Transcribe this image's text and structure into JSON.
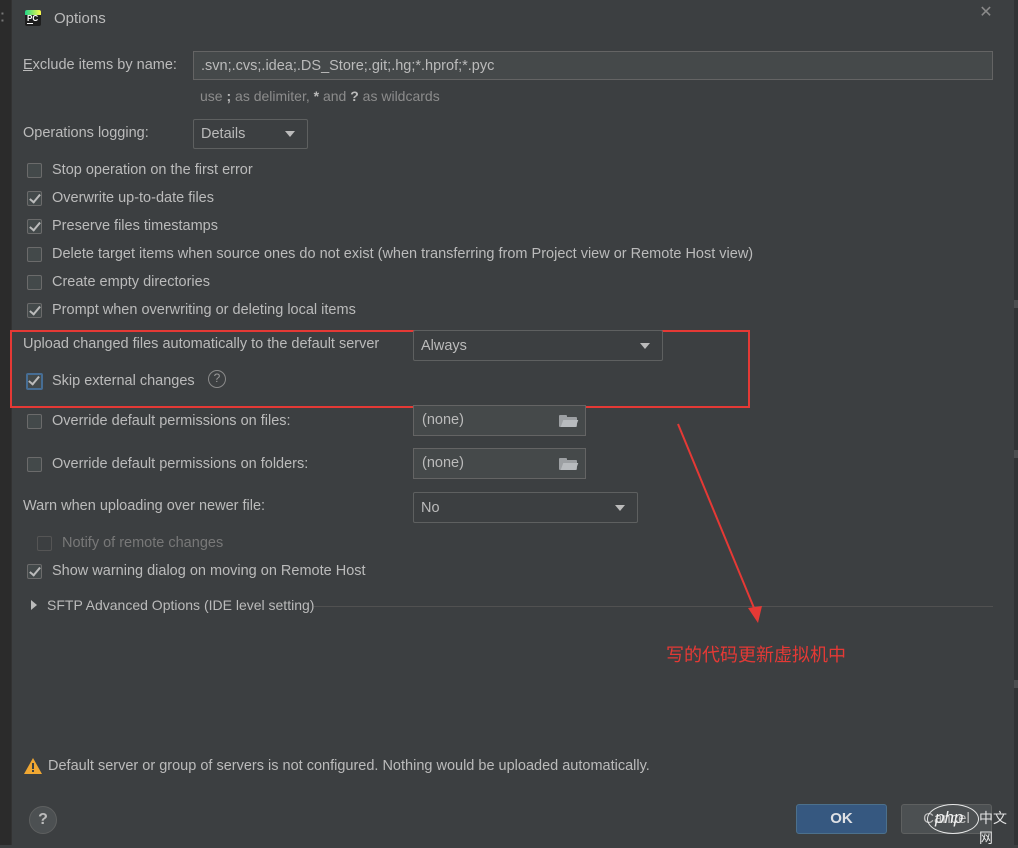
{
  "window": {
    "title": "Options",
    "app_icon_text": "PC"
  },
  "exclude": {
    "label": "Exclude items by name:",
    "value": ".svn;.cvs;.idea;.DS_Store;.git;.hg;*.hprof;*.pyc",
    "hint_pre": "use ",
    "hint_semicolon": ";",
    "hint_mid1": " as delimiter, ",
    "hint_star": "*",
    "hint_mid2": " and ",
    "hint_q": "?",
    "hint_post": " as wildcards"
  },
  "logging": {
    "label": "Operations logging:",
    "value": "Details"
  },
  "checkboxes": [
    {
      "label": "Stop operation on the first error",
      "checked": false
    },
    {
      "label": "Overwrite up-to-date files",
      "checked": true
    },
    {
      "label": "Preserve files timestamps",
      "checked": true
    },
    {
      "label": "Delete target items when source ones do not exist (when transferring from Project view or Remote Host view)",
      "checked": false
    },
    {
      "label": "Create empty directories",
      "checked": false
    },
    {
      "label": "Prompt when overwriting or deleting local items",
      "checked": true
    }
  ],
  "upload": {
    "label": "Upload changed files automatically to the default server",
    "value": "Always",
    "skip_label": "Skip external changes",
    "skip_checked": true,
    "help_glyph": "?"
  },
  "permissions": {
    "files_label": "Override default permissions on files:",
    "files_value": "(none)",
    "folders_label": "Override default permissions on folders:",
    "folders_value": "(none)"
  },
  "warn": {
    "label": "Warn when uploading over newer file:",
    "value": "No"
  },
  "notify": {
    "label": "Notify of remote changes",
    "checked": false,
    "disabled": true
  },
  "show_warning": {
    "label": "Show warning dialog on moving on Remote Host",
    "checked": true
  },
  "sftp": {
    "label": "SFTP Advanced Options (IDE level setting)"
  },
  "annotation": {
    "text": "写的代码更新虚拟机中",
    "color": "#e53935"
  },
  "footer": {
    "warning": "Default server or group of servers is not configured. Nothing would be uploaded automatically.",
    "help_glyph": "?",
    "ok": "OK",
    "cancel": "Cancel"
  },
  "watermark": {
    "brand": "php",
    "cn": "中文网"
  },
  "colors": {
    "background": "#3c3f41",
    "text": "#bbbbbb",
    "primary_button": "#365880",
    "highlight_box": "#e53935",
    "warning_icon": "#f0a732"
  }
}
